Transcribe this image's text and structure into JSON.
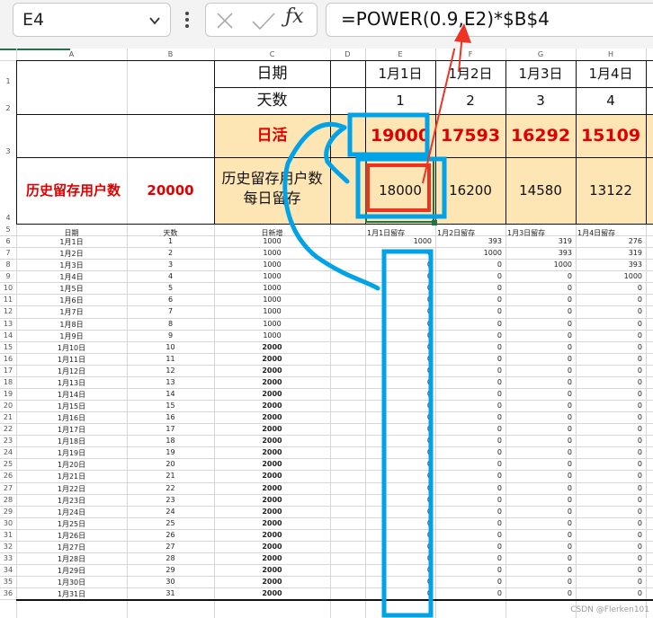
{
  "formula_bar": {
    "name_box": "E4",
    "formula": "=POWER(0.9,E2)*$B$4",
    "icons": [
      "chevron-down-icon",
      "more-dots-icon",
      "cancel-icon",
      "confirm-icon",
      "fx-icon"
    ]
  },
  "columns": [
    "A",
    "B",
    "C",
    "D",
    "E",
    "F",
    "G",
    "H"
  ],
  "rows_top": [
    "1",
    "2",
    "3",
    "4"
  ],
  "header_block": {
    "date_label": "日期",
    "days_label": "天数",
    "dau_label": "日活",
    "hist_label": "历史留存用户数",
    "hist_value": "20000",
    "hist_daily_line1": "历史留存用户数",
    "hist_daily_line2": "每日留存",
    "dates": [
      "1月1日",
      "1月2日",
      "1月3日",
      "1月4日"
    ],
    "days": [
      "1",
      "2",
      "3",
      "4"
    ],
    "dau": [
      "19000",
      "17593",
      "16292",
      "15109"
    ],
    "daily_retention": [
      "18000",
      "16200",
      "14580",
      "13122"
    ]
  },
  "table": {
    "headers": [
      "日期",
      "天数",
      "日新增",
      "1月1日留存",
      "1月2日留存",
      "1月3日留存",
      "1月4日留存"
    ],
    "row_numbers": [
      "5",
      "6",
      "7",
      "8",
      "9",
      "10",
      "11",
      "12",
      "13",
      "14",
      "15",
      "16",
      "17",
      "18",
      "19",
      "20",
      "21",
      "22",
      "23",
      "24",
      "25",
      "26",
      "27",
      "28",
      "29",
      "30",
      "31",
      "32",
      "33",
      "34",
      "35",
      "36"
    ],
    "rows": [
      [
        "1月1日",
        "1",
        "1000",
        "1000",
        "393",
        "319",
        "276"
      ],
      [
        "1月2日",
        "2",
        "1000",
        "0",
        "1000",
        "393",
        "319"
      ],
      [
        "1月3日",
        "3",
        "1000",
        "0",
        "0",
        "1000",
        "393"
      ],
      [
        "1月4日",
        "4",
        "1000",
        "0",
        "0",
        "0",
        "1000"
      ],
      [
        "1月5日",
        "5",
        "1000",
        "0",
        "0",
        "0",
        "0"
      ],
      [
        "1月6日",
        "6",
        "1000",
        "0",
        "0",
        "0",
        "0"
      ],
      [
        "1月7日",
        "7",
        "1000",
        "0",
        "0",
        "0",
        "0"
      ],
      [
        "1月8日",
        "8",
        "1000",
        "0",
        "0",
        "0",
        "0"
      ],
      [
        "1月9日",
        "9",
        "1000",
        "0",
        "0",
        "0",
        "0"
      ],
      [
        "1月10日",
        "10",
        "2000",
        "0",
        "0",
        "0",
        "0"
      ],
      [
        "1月11日",
        "11",
        "2000",
        "0",
        "0",
        "0",
        "0"
      ],
      [
        "1月12日",
        "12",
        "2000",
        "0",
        "0",
        "0",
        "0"
      ],
      [
        "1月13日",
        "13",
        "2000",
        "0",
        "0",
        "0",
        "0"
      ],
      [
        "1月14日",
        "14",
        "2000",
        "0",
        "0",
        "0",
        "0"
      ],
      [
        "1月15日",
        "15",
        "2000",
        "0",
        "0",
        "0",
        "0"
      ],
      [
        "1月16日",
        "16",
        "2000",
        "0",
        "0",
        "0",
        "0"
      ],
      [
        "1月17日",
        "17",
        "2000",
        "0",
        "0",
        "0",
        "0"
      ],
      [
        "1月18日",
        "18",
        "2000",
        "0",
        "0",
        "0",
        "0"
      ],
      [
        "1月19日",
        "19",
        "2000",
        "0",
        "0",
        "0",
        "0"
      ],
      [
        "1月20日",
        "20",
        "2000",
        "0",
        "0",
        "0",
        "0"
      ],
      [
        "1月21日",
        "21",
        "2000",
        "0",
        "0",
        "0",
        "0"
      ],
      [
        "1月22日",
        "22",
        "2000",
        "0",
        "0",
        "0",
        "0"
      ],
      [
        "1月23日",
        "23",
        "2000",
        "0",
        "0",
        "0",
        "0"
      ],
      [
        "1月24日",
        "24",
        "2000",
        "0",
        "0",
        "0",
        "0"
      ],
      [
        "1月25日",
        "25",
        "2000",
        "0",
        "0",
        "0",
        "0"
      ],
      [
        "1月26日",
        "26",
        "2000",
        "0",
        "0",
        "0",
        "0"
      ],
      [
        "1月27日",
        "27",
        "2000",
        "0",
        "0",
        "0",
        "0"
      ],
      [
        "1月28日",
        "28",
        "2000",
        "0",
        "0",
        "0",
        "0"
      ],
      [
        "1月29日",
        "29",
        "2000",
        "0",
        "0",
        "0",
        "0"
      ],
      [
        "1月30日",
        "30",
        "2000",
        "0",
        "0",
        "0",
        "0"
      ],
      [
        "1月31日",
        "31",
        "2000",
        "0",
        "0",
        "0",
        "0"
      ]
    ]
  },
  "watermark": "CSDN @Flerken101",
  "colors": {
    "highlight_fill": "#fde5b4",
    "red_text": "#e00000",
    "annotation_blue": "#00a2e8",
    "annotation_red": "#ee3322",
    "selection_green": "#217346"
  }
}
